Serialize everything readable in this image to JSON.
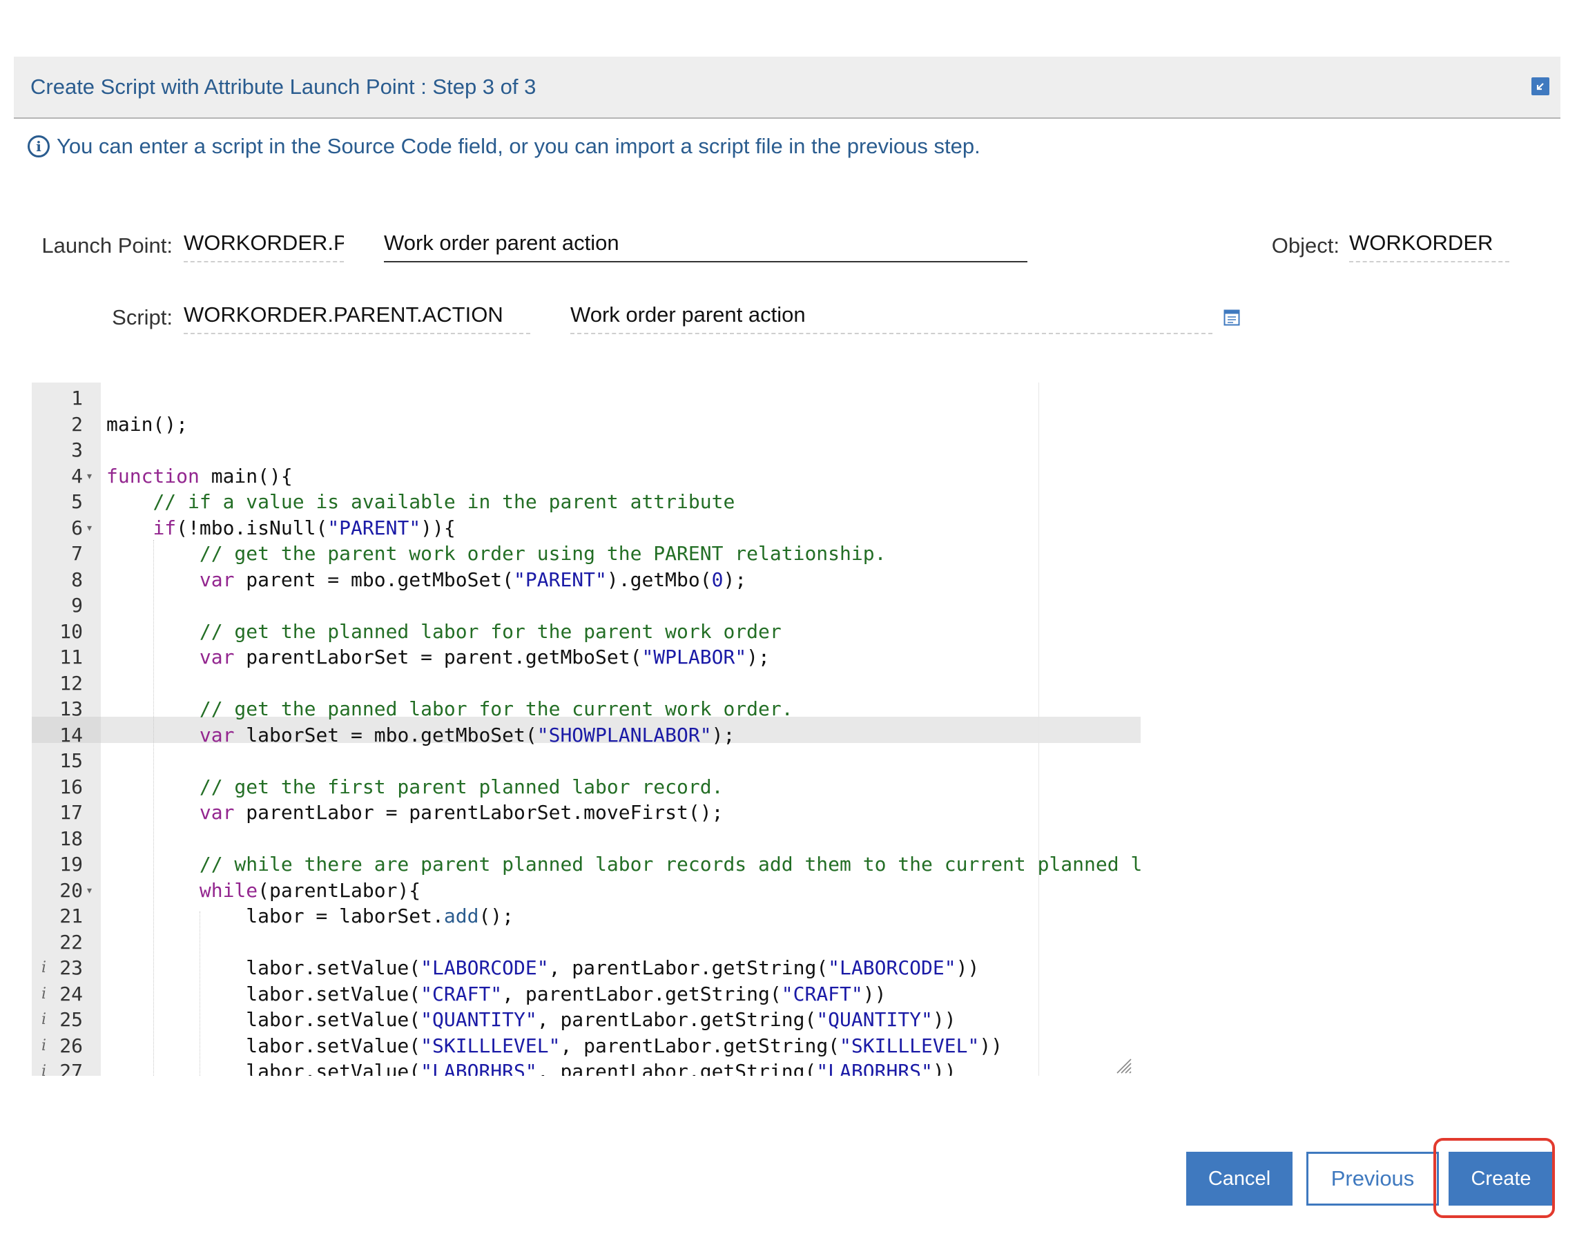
{
  "dialog": {
    "title": "Create Script with Attribute Launch Point : Step 3 of 3",
    "info": "You can enter a script in the Source Code field, or you can import a script file in the previous step."
  },
  "fields": {
    "launch_point_label": "Launch Point:",
    "launch_point_value": "WORKORDER.PA",
    "launch_point_desc": "Work order parent action",
    "object_label": "Object:",
    "object_value": "WORKORDER",
    "script_label": "Script:",
    "script_value": "WORKORDER.PARENT.ACTION",
    "script_desc": "Work order parent action"
  },
  "editor": {
    "lines": [
      {
        "n": "1",
        "code": ""
      },
      {
        "n": "2",
        "code": "main();"
      },
      {
        "n": "3",
        "code": ""
      },
      {
        "n": "4",
        "code": "function main(){"
      },
      {
        "n": "5",
        "code": "    // if a value is available in the parent attribute"
      },
      {
        "n": "6",
        "code": "    if(!mbo.isNull(\"PARENT\")){"
      },
      {
        "n": "7",
        "code": "        // get the parent work order using the PARENT relationship."
      },
      {
        "n": "8",
        "code": "        var parent = mbo.getMboSet(\"PARENT\").getMbo(0);"
      },
      {
        "n": "9",
        "code": ""
      },
      {
        "n": "10",
        "code": "        // get the planned labor for the parent work order"
      },
      {
        "n": "11",
        "code": "        var parentLaborSet = parent.getMboSet(\"WPLABOR\");"
      },
      {
        "n": "12",
        "code": ""
      },
      {
        "n": "13",
        "code": "        // get the panned labor for the current work order."
      },
      {
        "n": "14",
        "code": "        var laborSet = mbo.getMboSet(\"SHOWPLANLABOR\");"
      },
      {
        "n": "15",
        "code": ""
      },
      {
        "n": "16",
        "code": "        // get the first parent planned labor record."
      },
      {
        "n": "17",
        "code": "        var parentLabor = parentLaborSet.moveFirst();"
      },
      {
        "n": "18",
        "code": ""
      },
      {
        "n": "19",
        "code": "        // while there are parent planned labor records add them to the current planned l"
      },
      {
        "n": "20",
        "code": "        while(parentLabor){"
      },
      {
        "n": "21",
        "code": "            labor = laborSet.add();"
      },
      {
        "n": "22",
        "code": ""
      },
      {
        "n": "23",
        "code": "            labor.setValue(\"LABORCODE\", parentLabor.getString(\"LABORCODE\"))"
      },
      {
        "n": "24",
        "code": "            labor.setValue(\"CRAFT\", parentLabor.getString(\"CRAFT\"))"
      },
      {
        "n": "25",
        "code": "            labor.setValue(\"QUANTITY\", parentLabor.getString(\"QUANTITY\"))"
      },
      {
        "n": "26",
        "code": "            labor.setValue(\"SKILLLEVEL\", parentLabor.getString(\"SKILLLEVEL\"))"
      },
      {
        "n": "27",
        "code": "            labor.setValue(\"LABORHRS\", parentLabor.getString(\"LABORHRS\"))"
      }
    ],
    "fold_lines": [
      "4",
      "6",
      "20"
    ],
    "annotated_lines": [
      "23",
      "24",
      "25",
      "26",
      "27"
    ],
    "active_line": "14",
    "annotation_glyph": "i",
    "fold_glyph": "▾"
  },
  "buttons": {
    "cancel": "Cancel",
    "previous": "Previous",
    "create": "Create"
  },
  "colors": {
    "accent": "#3f79bf",
    "title_text": "#2a5c8f",
    "highlight": "#e23a2e",
    "comment": "#236e25",
    "keyword": "#93268f",
    "string": "#1a1aa6"
  }
}
